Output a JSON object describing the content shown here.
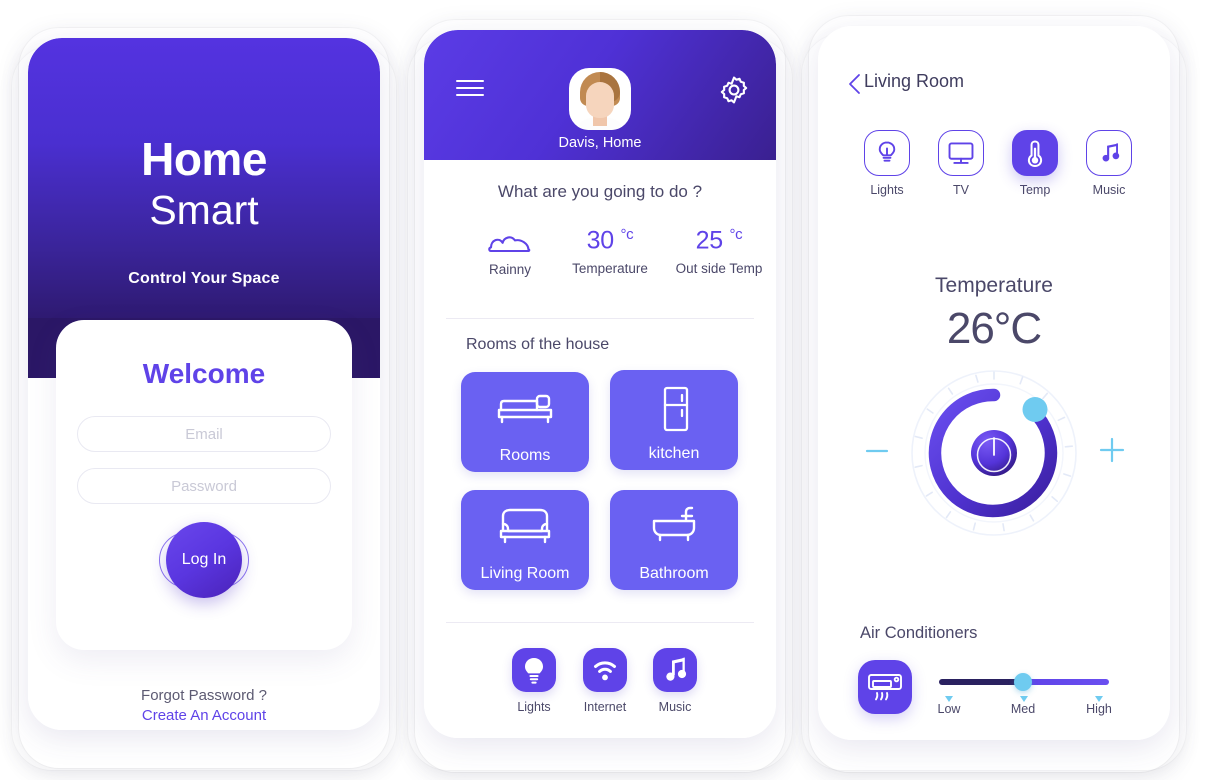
{
  "app": {
    "accent": "#5f43e8",
    "accent_light": "#6a61f2",
    "cyan": "#6fcbf0",
    "dark": "#2b1766"
  },
  "screen1": {
    "brand_line1": "Home",
    "brand_line2": "Smart",
    "tagline": "Control Your Space",
    "welcome": "Welcome",
    "email_placeholder": "Email",
    "email_value": "",
    "password_placeholder": "Password",
    "password_value": "",
    "login_label": "Log In",
    "forgot_label": "Forgot Password ?",
    "create_label": "Create An Account"
  },
  "screen2": {
    "menu_icon": "hamburger-icon",
    "settings_icon": "gear-icon",
    "avatar_icon": "avatar",
    "user_name": "Davis, Home",
    "question": "What are you going to do ?",
    "weather": [
      {
        "icon": "cloud-icon",
        "value": "",
        "unit": "",
        "label": "Rainny"
      },
      {
        "icon": "",
        "value": "30",
        "unit": "°c",
        "label": "Temperature"
      },
      {
        "icon": "",
        "value": "25",
        "unit": "°c",
        "label": "Out side Temp"
      }
    ],
    "rooms_title": "Rooms of the house",
    "rooms": [
      {
        "label": "Rooms",
        "icon": "bed-icon"
      },
      {
        "label": "kitchen",
        "icon": "fridge-icon"
      },
      {
        "label": "Living Room",
        "icon": "sofa-icon"
      },
      {
        "label": "Bathroom",
        "icon": "bathtub-icon"
      }
    ],
    "quick_actions": [
      {
        "label": "Lights",
        "icon": "bulb-icon"
      },
      {
        "label": "Internet",
        "icon": "wifi-icon"
      },
      {
        "label": "Music",
        "icon": "music-note-icon"
      }
    ]
  },
  "screen3": {
    "back_icon": "chevron-left-icon",
    "title": "Living Room",
    "devices": [
      {
        "label": "Lights",
        "icon": "bulb-icon",
        "active": false
      },
      {
        "label": "TV",
        "icon": "tv-icon",
        "active": false
      },
      {
        "label": "Temp",
        "icon": "thermometer-icon",
        "active": true
      },
      {
        "label": "Music",
        "icon": "music-note-icon",
        "active": false
      }
    ],
    "temp_title": "Temperature",
    "temp_value": "26°C",
    "dial": {
      "minus_label": "−",
      "plus_label": "+",
      "power_icon": "power-icon",
      "handle_angle_deg": 52,
      "arc_percent": 88
    },
    "ac_title": "Air Conditioners",
    "ac_icon": "air-conditioner-icon",
    "slider": {
      "value": "Med",
      "ticks": [
        "Low",
        "Med",
        "High"
      ]
    }
  }
}
